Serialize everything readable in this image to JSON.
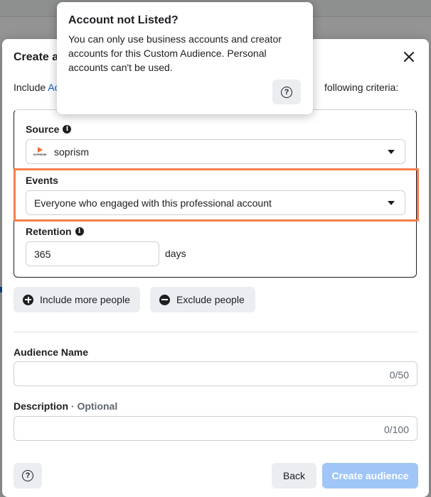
{
  "modal": {
    "title": "Create a",
    "intro_prefix": "Include ",
    "intro_link": "Ac",
    "intro_suffix": "following criteria:",
    "source": {
      "label": "Source",
      "value": "soprism",
      "logo_text": "SOPRISM"
    },
    "events": {
      "label": "Events",
      "value": "Everyone who engaged with this professional account"
    },
    "retention": {
      "label": "Retention",
      "value": "365",
      "unit": "days"
    },
    "include_more_label": "Include more people",
    "exclude_label": "Exclude people",
    "audience_name": {
      "label": "Audience Name",
      "value": "",
      "counter": "0/50"
    },
    "description": {
      "label": "Description",
      "optional": " · Optional",
      "value": "",
      "counter": "0/100"
    },
    "back_label": "Back",
    "create_label": "Create audience"
  },
  "tooltip": {
    "title": "Account not Listed?",
    "body": "You can only use business accounts and creator accounts for this Custom Audience. Personal accounts can't be used."
  },
  "colors": {
    "highlight": "#f47f4f",
    "primary_disabled": "#9fc6f7",
    "link": "#0a5cc2"
  }
}
